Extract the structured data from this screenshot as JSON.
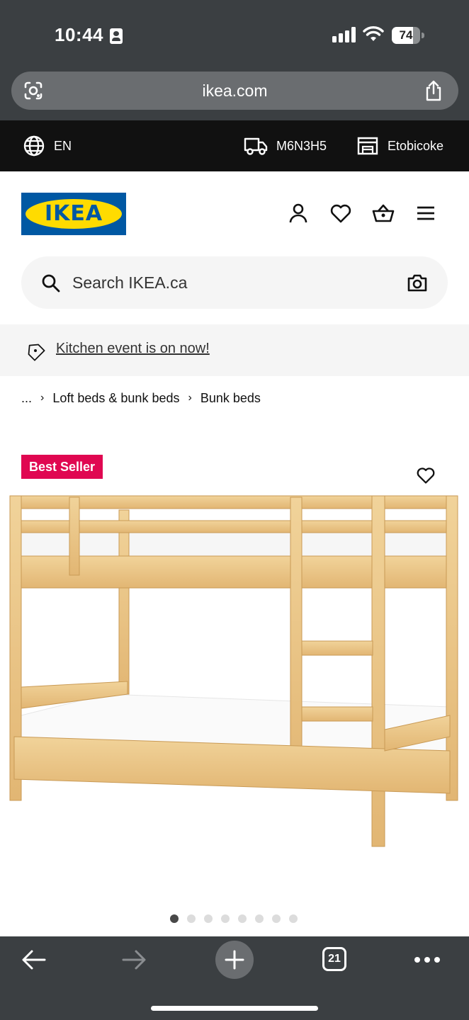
{
  "status_bar": {
    "time": "10:44",
    "battery": "74",
    "battery_level": 0.74
  },
  "browser": {
    "url": "ikea.com",
    "tab_count": "21"
  },
  "util_bar": {
    "language": "EN",
    "postal_code": "M6N3H5",
    "store": "Etobicoke"
  },
  "header": {
    "logo_text": "IKEA"
  },
  "search": {
    "placeholder": "Search IKEA.ca"
  },
  "promo": {
    "text": "Kitchen event is on now!"
  },
  "breadcrumb": {
    "items": [
      "...",
      "Loft beds & bunk beds",
      "Bunk beds"
    ]
  },
  "product": {
    "badge": "Best Seller",
    "image_count": 8,
    "active_image": 1
  },
  "colors": {
    "chrome": "#3b3f42",
    "ikea_blue": "#0058a3",
    "ikea_yellow": "#ffdb00",
    "badge_red": "#e00751"
  }
}
